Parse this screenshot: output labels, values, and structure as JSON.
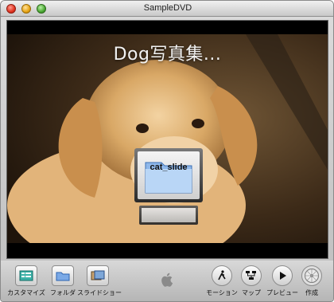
{
  "window": {
    "title": "SampleDVD"
  },
  "menu": {
    "title": "Dog写真集...",
    "buttons": [
      {
        "label": "cat_slide"
      }
    ]
  },
  "toolbar": {
    "left": [
      {
        "label": "カスタマイズ",
        "icon": "customize-icon"
      },
      {
        "label": "フォルダ",
        "icon": "folder-icon"
      },
      {
        "label": "スライドショー",
        "icon": "slideshow-icon"
      }
    ],
    "right": [
      {
        "label": "モーション",
        "icon": "motion-icon"
      },
      {
        "label": "マップ",
        "icon": "map-icon"
      },
      {
        "label": "プレビュー",
        "icon": "play-icon"
      },
      {
        "label": "作成",
        "icon": "burn-icon"
      }
    ]
  },
  "colors": {
    "accent": "#2b6fd6",
    "stage": "#000000"
  }
}
